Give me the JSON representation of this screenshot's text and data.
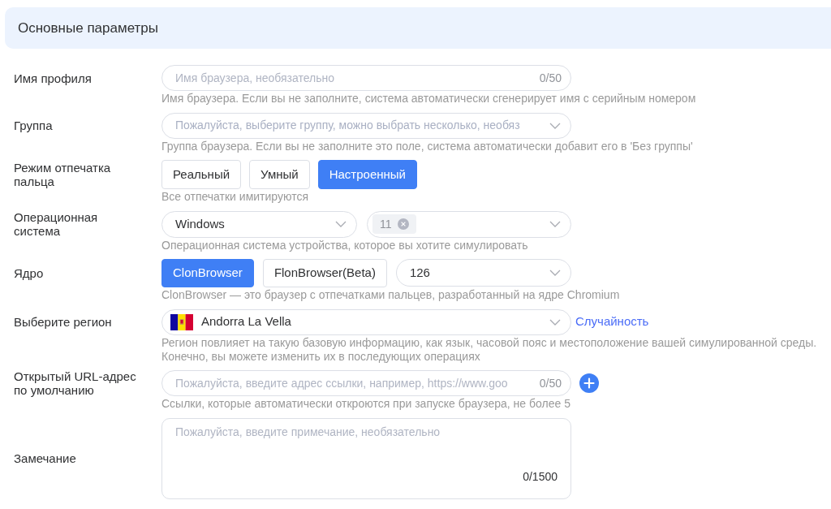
{
  "section": {
    "title": "Основные параметры"
  },
  "fields": [
    {
      "kind": "text_input",
      "label": "Имя профиля",
      "placeholder": "Имя браузера, необязательно",
      "counter": "0/50",
      "hint": "Имя браузера. Если вы не заполните, система автоматически сгенерирует имя с серийным номером"
    },
    {
      "kind": "select",
      "label": "Группа",
      "placeholder": "Пожалуйста, выберите группу, можно выбрать несколько, необяз",
      "hint": "Группа браузера. Если вы не заполните это поле, система автоматически добавит его в 'Без группы'"
    },
    {
      "kind": "segmented",
      "label": "Режим отпечатка пальца",
      "options": [
        {
          "label": "Реальный",
          "selected": false
        },
        {
          "label": "Умный",
          "selected": false
        },
        {
          "label": "Настроенный",
          "selected": true
        }
      ],
      "hint": "Все отпечатки имитируются"
    },
    {
      "kind": "os",
      "label": "Операционная система",
      "os_select": {
        "value": "Windows"
      },
      "version_select": {
        "tags": [
          "11"
        ]
      },
      "hint": "Операционная система устройства, которое вы хотите симулировать"
    },
    {
      "kind": "kernel",
      "label": "Ядро",
      "options": [
        {
          "label": "ClonBrowser",
          "selected": true
        },
        {
          "label": "FlonBrowser(Beta)",
          "selected": false
        }
      ],
      "version_select": {
        "value": "126"
      },
      "hint": "ClonBrowser — это браузер с отпечатками пальцев, разработанный на ядре Chromium"
    },
    {
      "kind": "region",
      "label": "Выберите регион",
      "value": "Andorra La Vella",
      "link": "Случайность",
      "hint": "Регион повлияет на такую базовую информацию, как язык, часовой пояс и местоположение вашей симулированной среды. Конечно, вы можете изменить их в последующих операциях"
    },
    {
      "kind": "url",
      "label": "Открытый URL-адрес по умолчанию",
      "placeholder": "Пожалуйста, введите адрес ссылки, например, https://www.goo",
      "counter": "0/50",
      "hint": "Ссылки, которые автоматически откроются при запуске браузера, не более 5"
    },
    {
      "kind": "textarea",
      "label": "Замечание",
      "placeholder": "Пожалуйста, введите примечание, необязательно",
      "counter": "0/1500"
    }
  ]
}
